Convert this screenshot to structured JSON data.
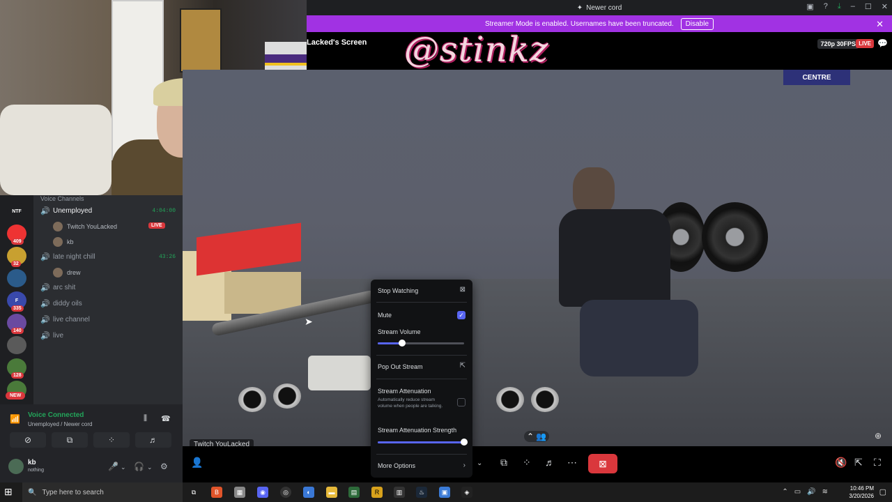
{
  "titlebar": {
    "title": "Newer cord",
    "icons": [
      "cast-icon",
      "help-icon",
      "download-icon",
      "minimize-icon",
      "maximize-icon",
      "close-icon"
    ]
  },
  "banner": {
    "text": "Streamer Mode is enabled. Usernames have been truncated.",
    "button": "Disable",
    "close": "✕",
    "color": "#a132e3"
  },
  "stream": {
    "screen_label": "Lacked's Screen",
    "logo": "@stinkz",
    "quality": "720p 30FPS",
    "live": "LIVE",
    "wall_sign": "CENTRE",
    "streamer_tag": "Twitch YouLacked",
    "expand": "⌃"
  },
  "server_rail": {
    "servers": [
      {
        "label": "NTF",
        "color": "#1e1f22"
      },
      {
        "label": "",
        "color": "#e33",
        "badge": "409"
      },
      {
        "label": "",
        "color": "#c8a030",
        "badge": "32"
      },
      {
        "label": "",
        "color": "#2b5b8a",
        "badge": ""
      },
      {
        "label": "F",
        "color": "#3949ab",
        "badge": "335"
      },
      {
        "label": "",
        "color": "#6a4aa0",
        "badge": "140"
      },
      {
        "label": "",
        "color": "#5a5a5a",
        "badge": ""
      },
      {
        "label": "",
        "color": "#4a7a3a",
        "badge": "128"
      },
      {
        "label": "",
        "color": "#4a7a3a",
        "badge": ""
      }
    ],
    "new_label": "NEW"
  },
  "channels": {
    "header": "Voice Channels",
    "list": [
      {
        "name": "Unemployed",
        "active": true,
        "timer": "4:04:00",
        "members": [
          {
            "name": "Twitch YouLacked",
            "live": "LIVE"
          },
          {
            "name": "kb",
            "live": ""
          }
        ]
      },
      {
        "name": "late night chill",
        "active": false,
        "timer": "43:26",
        "members": [
          {
            "name": "drew",
            "live": ""
          }
        ]
      },
      {
        "name": "arc shit",
        "active": false,
        "timer": "",
        "members": []
      },
      {
        "name": "diddy oils",
        "active": false,
        "timer": "",
        "members": []
      },
      {
        "name": "live channel",
        "active": false,
        "timer": "",
        "members": []
      },
      {
        "name": "live",
        "active": false,
        "timer": "",
        "members": []
      }
    ]
  },
  "voice_panel": {
    "status": "Voice Connected",
    "sub": "Unemployed / Newer cord",
    "user_name": "kb",
    "user_status": "nothing"
  },
  "menu": {
    "stop_watching": "Stop Watching",
    "mute": "Mute",
    "mute_checked": true,
    "stream_volume": "Stream Volume",
    "volume_level": 0.28,
    "pop_out": "Pop Out Stream",
    "attenuation": "Stream Attenuation",
    "attenuation_desc": "Automatically reduce stream volume when people are talking.",
    "attenuation_checked": false,
    "attenuation_strength": "Stream Attenuation Strength",
    "strength_level": 1.0,
    "more_options": "More Options",
    "accent": "#5865f2"
  },
  "taskbar": {
    "search_placeholder": "Type here to search",
    "time": "10:46 PM",
    "date": "3/20/2026"
  }
}
